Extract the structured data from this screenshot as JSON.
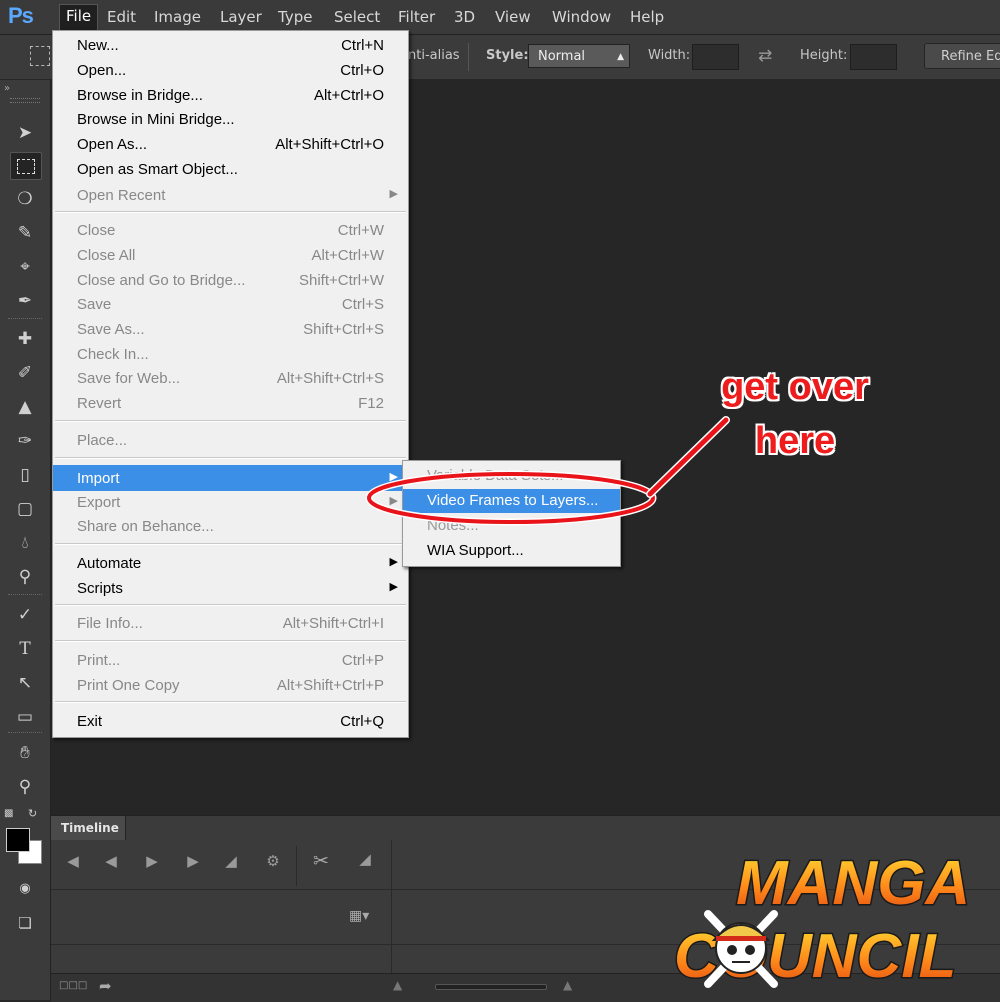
{
  "app": {
    "logo_text": "Ps"
  },
  "menubar": {
    "items": [
      "File",
      "Edit",
      "Image",
      "Layer",
      "Type",
      "Select",
      "Filter",
      "3D",
      "View",
      "Window",
      "Help"
    ],
    "active": "File"
  },
  "options_bar": {
    "anti_alias_label": "nti-alias",
    "style_label": "Style:",
    "style_value": "Normal",
    "width_label": "Width:",
    "height_label": "Height:",
    "refine_label": "Refine Edg"
  },
  "file_menu": {
    "groups": [
      [
        {
          "label": "New...",
          "shortcut": "Ctrl+N",
          "enabled": true
        },
        {
          "label": "Open...",
          "shortcut": "Ctrl+O",
          "enabled": true
        },
        {
          "label": "Browse in Bridge...",
          "shortcut": "Alt+Ctrl+O",
          "enabled": true
        },
        {
          "label": "Browse in Mini Bridge...",
          "shortcut": "",
          "enabled": true
        },
        {
          "label": "Open As...",
          "shortcut": "Alt+Shift+Ctrl+O",
          "enabled": true
        },
        {
          "label": "Open as Smart Object...",
          "shortcut": "",
          "enabled": true
        },
        {
          "label": "Open Recent",
          "shortcut": "",
          "enabled": false,
          "submenu": true
        }
      ],
      [
        {
          "label": "Close",
          "shortcut": "Ctrl+W",
          "enabled": false
        },
        {
          "label": "Close All",
          "shortcut": "Alt+Ctrl+W",
          "enabled": false
        },
        {
          "label": "Close and Go to Bridge...",
          "shortcut": "Shift+Ctrl+W",
          "enabled": false
        },
        {
          "label": "Save",
          "shortcut": "Ctrl+S",
          "enabled": false
        },
        {
          "label": "Save As...",
          "shortcut": "Shift+Ctrl+S",
          "enabled": false
        },
        {
          "label": "Check In...",
          "shortcut": "",
          "enabled": false
        },
        {
          "label": "Save for Web...",
          "shortcut": "Alt+Shift+Ctrl+S",
          "enabled": false
        },
        {
          "label": "Revert",
          "shortcut": "F12",
          "enabled": false
        }
      ],
      [
        {
          "label": "Place...",
          "shortcut": "",
          "enabled": false
        }
      ],
      [
        {
          "label": "Import",
          "shortcut": "",
          "enabled": true,
          "submenu": true,
          "highlighted": true
        },
        {
          "label": "Export",
          "shortcut": "",
          "enabled": false,
          "submenu": true
        },
        {
          "label": "Share on Behance...",
          "shortcut": "",
          "enabled": false
        }
      ],
      [
        {
          "label": "Automate",
          "shortcut": "",
          "enabled": true,
          "submenu": true
        },
        {
          "label": "Scripts",
          "shortcut": "",
          "enabled": true,
          "submenu": true
        }
      ],
      [
        {
          "label": "File Info...",
          "shortcut": "Alt+Shift+Ctrl+I",
          "enabled": false
        }
      ],
      [
        {
          "label": "Print...",
          "shortcut": "Ctrl+P",
          "enabled": false
        },
        {
          "label": "Print One Copy",
          "shortcut": "Alt+Shift+Ctrl+P",
          "enabled": false
        }
      ],
      [
        {
          "label": "Exit",
          "shortcut": "Ctrl+Q",
          "enabled": true
        }
      ]
    ]
  },
  "import_submenu": {
    "items": [
      {
        "label": "Variable Data Sets...",
        "enabled": false
      },
      {
        "label": "Video Frames to Layers...",
        "enabled": true,
        "highlighted": true
      },
      {
        "label": "Notes...",
        "enabled": false
      },
      {
        "label": "WIA Support...",
        "enabled": true
      }
    ]
  },
  "timeline": {
    "tab_label": "Timeline"
  },
  "annotation": {
    "line1": "get over",
    "line2": "here",
    "color": "#ee1d1d"
  },
  "watermark": {
    "line1": "MANGA",
    "line2": "COUNCIL"
  },
  "colors": {
    "highlight": "#3c8fe6",
    "ps_blue": "#5aa9ff",
    "menu_bg": "#f0f0f0",
    "canvas_bg": "#262626"
  }
}
